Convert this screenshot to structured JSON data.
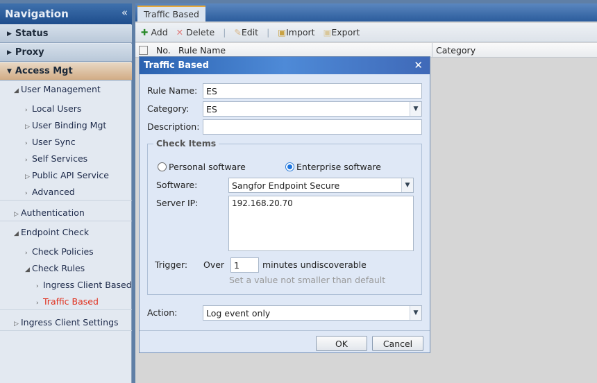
{
  "nav": {
    "title": "Navigation",
    "collapse": "«",
    "top": [
      "Status",
      "Proxy",
      "Access Mgt"
    ],
    "tree": [
      {
        "label": "User Management",
        "lvl": 0,
        "g": "◢"
      },
      {
        "label": "Local Users",
        "lvl": 1,
        "g": "›"
      },
      {
        "label": "User Binding Mgt",
        "lvl": 1,
        "g": "▷"
      },
      {
        "label": "User Sync",
        "lvl": 1,
        "g": "›"
      },
      {
        "label": "Self Services",
        "lvl": 1,
        "g": "›"
      },
      {
        "label": "Public API Service",
        "lvl": 1,
        "g": "▷"
      },
      {
        "label": "Advanced",
        "lvl": 1,
        "g": "›"
      },
      {
        "label": "Authentication",
        "lvl": 0,
        "g": "▷"
      },
      {
        "label": "Endpoint Check",
        "lvl": 0,
        "g": "◢"
      },
      {
        "label": "Check Policies",
        "lvl": 1,
        "g": "›"
      },
      {
        "label": "Check Rules",
        "lvl": 1,
        "g": "◢"
      },
      {
        "label": "Ingress Client Based",
        "lvl": 2,
        "g": "›"
      },
      {
        "label": "Traffic Based",
        "lvl": 2,
        "g": "›",
        "active": true
      },
      {
        "label": "Ingress Client Settings",
        "lvl": 0,
        "g": "▷"
      }
    ]
  },
  "tab": "Traffic Based",
  "toolbar": {
    "add": "Add",
    "delete": "Delete",
    "edit": "Edit",
    "import": "Import",
    "export": "Export"
  },
  "grid": {
    "cols": [
      "No.",
      "Rule Name",
      "Category"
    ]
  },
  "dialog": {
    "title": "Traffic Based",
    "rule_name_label": "Rule Name:",
    "rule_name": "ES",
    "category_label": "Category:",
    "category": "ES",
    "description_label": "Description:",
    "description": "",
    "check_items": "Check Items",
    "personal": "Personal software",
    "enterprise": "Enterprise software",
    "software_label": "Software:",
    "software": "Sangfor Endpoint Secure",
    "server_ip_label": "Server IP:",
    "server_ip": "192.168.20.70",
    "trigger_label": "Trigger:",
    "over": "Over",
    "trigger_value": "1",
    "minutes": "minutes undiscoverable",
    "hint": "Set a value not smaller than default",
    "action_label": "Action:",
    "action": "Log event only",
    "ok": "OK",
    "cancel": "Cancel"
  },
  "colors": {
    "active": "#e0301e",
    "accent": "#2b62b0"
  }
}
